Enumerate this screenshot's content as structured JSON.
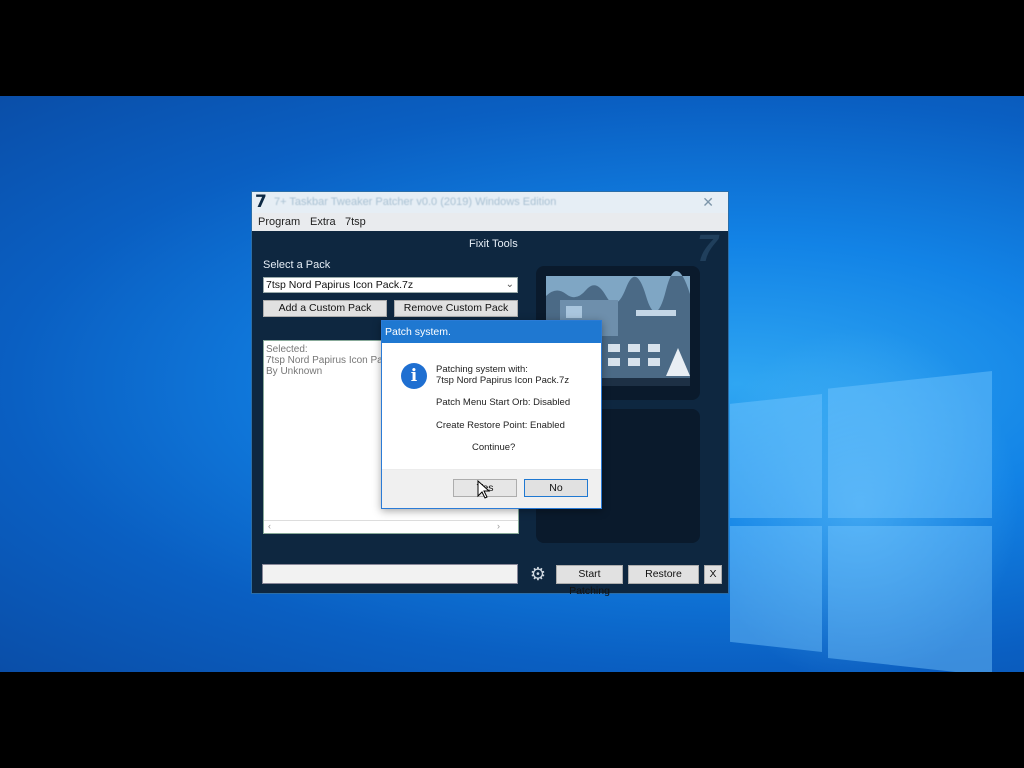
{
  "window": {
    "title": "7+ Taskbar Tweaker Patcher v0.0 (2019) Windows Edition",
    "app_icon": "7",
    "close_label": "✕"
  },
  "menu": [
    "Program",
    "Extra",
    "7tsp"
  ],
  "header": {
    "title": "Fixit Tools"
  },
  "pack": {
    "select_label": "Select a Pack",
    "selected_value": "7tsp Nord Papirus Icon Pack.7z",
    "add_button": "Add a Custom Pack",
    "remove_button": "Remove Custom Pack"
  },
  "info_box": {
    "lines": [
      "Selected:",
      "7tsp Nord Papirus Icon Pack",
      "By Unknown"
    ]
  },
  "bottom": {
    "start_button": "Start Patching",
    "restore_button": "Restore",
    "close_button": "X"
  },
  "dialog": {
    "title": "Patch system.",
    "line1": "Patching system with:",
    "line2": "7tsp Nord Papirus Icon Pack.7z",
    "line3": "Patch Menu Start Orb: Disabled",
    "line4": "Create Restore Point: Enabled",
    "line5": "Continue?",
    "yes_button": "Yes",
    "no_button": "No",
    "icon": "info-icon"
  },
  "colors": {
    "desktop_blue": "#1283e6",
    "window_bg": "#0e2740",
    "dialog_title": "#1f78d1",
    "info_icon": "#1f6fd1"
  }
}
